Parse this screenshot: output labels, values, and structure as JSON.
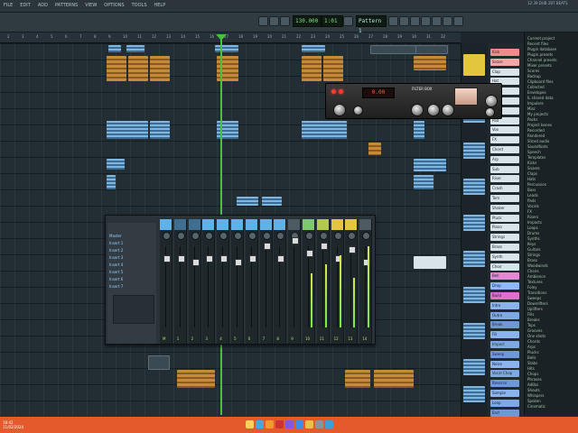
{
  "app": {
    "title": "FL Studio"
  },
  "menu": [
    "FILE",
    "EDIT",
    "ADD",
    "PATTERNS",
    "VIEW",
    "OPTIONS",
    "TOOLS",
    "HELP"
  ],
  "toolbar": {
    "time": "1:01",
    "tempo": "130.000",
    "pattern": "Pattern 1"
  },
  "hint": "12:39 DUB 2BT BEATS",
  "ruler_ticks": [
    "2",
    "3",
    "4",
    "5",
    "6",
    "7",
    "8",
    "9",
    "10",
    "11",
    "12",
    "13",
    "14",
    "15",
    "16",
    "17",
    "18",
    "19",
    "20",
    "21",
    "22",
    "23",
    "24",
    "25",
    "26",
    "27",
    "28",
    "29",
    "30",
    "31",
    "32"
  ],
  "picker": [
    {
      "label": "Kick",
      "color": "#f28c8c"
    },
    {
      "label": "Snare",
      "color": "#f3a8a8"
    },
    {
      "label": "Clap",
      "color": "#d9e4ea"
    },
    {
      "label": "Hat",
      "color": "#d9e4ea"
    },
    {
      "label": "Perc",
      "color": "#d9e4ea"
    },
    {
      "label": "Bass",
      "color": "#d9e4ea"
    },
    {
      "label": "Lead",
      "color": "#d9e4ea"
    },
    {
      "label": "Pad",
      "color": "#d9e4ea"
    },
    {
      "label": "Vox",
      "color": "#d9e4ea"
    },
    {
      "label": "FX",
      "color": "#d9e4ea"
    },
    {
      "label": "Chord",
      "color": "#d9e4ea"
    },
    {
      "label": "Arp",
      "color": "#d9e4ea"
    },
    {
      "label": "Sub",
      "color": "#d9e4ea"
    },
    {
      "label": "Riser",
      "color": "#d9e4ea"
    },
    {
      "label": "Crash",
      "color": "#d9e4ea"
    },
    {
      "label": "Tom",
      "color": "#d9e4ea"
    },
    {
      "label": "Shaker",
      "color": "#d9e4ea"
    },
    {
      "label": "Pluck",
      "color": "#d9e4ea"
    },
    {
      "label": "Piano",
      "color": "#d9e4ea"
    },
    {
      "label": "Strings",
      "color": "#d9e4ea"
    },
    {
      "label": "Brass",
      "color": "#d9e4ea"
    },
    {
      "label": "Synth",
      "color": "#d9e4ea"
    },
    {
      "label": "Choir",
      "color": "#d9e4ea"
    },
    {
      "label": "Bell",
      "color": "#e08ad6"
    },
    {
      "label": "Drop",
      "color": "#8fb8ff"
    },
    {
      "label": "Build",
      "color": "#e26fd0"
    },
    {
      "label": "Intro",
      "color": "#8ab3f0"
    },
    {
      "label": "Outro",
      "color": "#7fa8e8"
    },
    {
      "label": "Break",
      "color": "#6f98d8"
    },
    {
      "label": "Fill",
      "color": "#8ab3f0"
    },
    {
      "label": "Impact",
      "color": "#7fa8e8"
    },
    {
      "label": "Sweep",
      "color": "#6f98d8"
    },
    {
      "label": "Noise",
      "color": "#8ab3f0"
    },
    {
      "label": "Vocal Chop",
      "color": "#7fa8e8"
    },
    {
      "label": "Reverse",
      "color": "#6f98d8"
    },
    {
      "label": "Sample",
      "color": "#8ab3f0"
    },
    {
      "label": "Loop",
      "color": "#7fa8e8"
    },
    {
      "label": "End",
      "color": "#6f98d8"
    }
  ],
  "browser": [
    "Current project",
    "Recent files",
    "Plugin database",
    "Plugin presets",
    "Channel presets",
    "Mixer presets",
    "Scores",
    "Backup",
    "Clipboard files",
    "Collected",
    "Envelopes",
    "IL shared data",
    "Impulses",
    "Misc",
    "My projects",
    "Packs",
    "Project bones",
    "Recorded",
    "Rendered",
    "Sliced audio",
    "Soundfonts",
    "Speech",
    "Templates",
    "Kicks",
    "Snares",
    "Claps",
    "Hats",
    "Percussion",
    "Bass",
    "Leads",
    "Pads",
    "Vocals",
    "FX",
    "Risers",
    "Impacts",
    "Loops",
    "Drums",
    "Synths",
    "Keys",
    "Guitars",
    "Strings",
    "Brass",
    "Woodwinds",
    "Choirs",
    "Ambience",
    "Textures",
    "Foley",
    "Transitions",
    "Sweeps",
    "Downlifters",
    "Uplifters",
    "Fills",
    "Breaks",
    "Tops",
    "Grooves",
    "One shots",
    "Chords",
    "Arps",
    "Plucks",
    "Bells",
    "Stabs",
    "Hits",
    "Chops",
    "Phrases",
    "Adlibs",
    "Shouts",
    "Whispers",
    "Spoken",
    "Cinematic"
  ],
  "plugin": {
    "name": "FILTER BOX",
    "display": "0.00"
  },
  "mixer": {
    "left_labels": [
      "Master",
      "Insert 1",
      "Insert 2",
      "Insert 3",
      "Insert 4",
      "Insert 5",
      "Insert 6",
      "Insert 7"
    ],
    "strips": [
      {
        "color": "#5fb2e8",
        "label": "M"
      },
      {
        "color": "#3f6e8e",
        "label": "1"
      },
      {
        "color": "#3f6e8e",
        "label": "2"
      },
      {
        "color": "#5fb2e8",
        "label": "3"
      },
      {
        "color": "#5fb2e8",
        "label": "4"
      },
      {
        "color": "#5fb2e8",
        "label": "5"
      },
      {
        "color": "#5fb2e8",
        "label": "6"
      },
      {
        "color": "#5fb2e8",
        "label": "7"
      },
      {
        "color": "#5fb2e8",
        "label": "8"
      },
      {
        "color": "#4e5a62",
        "label": "9"
      },
      {
        "color": "#7ec86b",
        "label": "10"
      },
      {
        "color": "#b3c94a",
        "label": "11"
      },
      {
        "color": "#e3c53e",
        "label": "12"
      },
      {
        "color": "#e3c53e",
        "label": "13"
      },
      {
        "color": "#4e5a62",
        "label": "14"
      }
    ]
  },
  "clock": {
    "time": "18:42",
    "date": "11/02/2024"
  },
  "taskbar_icons": [
    {
      "name": "explorer-icon",
      "color": "#f3d35b"
    },
    {
      "name": "browser-icon",
      "color": "#4aa3e8"
    },
    {
      "name": "fl-studio-icon",
      "color": "#f39a2e"
    },
    {
      "name": "media-icon",
      "color": "#c33"
    },
    {
      "name": "chat-icon",
      "color": "#7a5be8"
    },
    {
      "name": "store-icon",
      "color": "#3b8ee8"
    },
    {
      "name": "folder-icon",
      "color": "#e8c04a"
    },
    {
      "name": "settings-icon",
      "color": "#8894a0"
    },
    {
      "name": "mail-icon",
      "color": "#3aa0d8"
    }
  ]
}
